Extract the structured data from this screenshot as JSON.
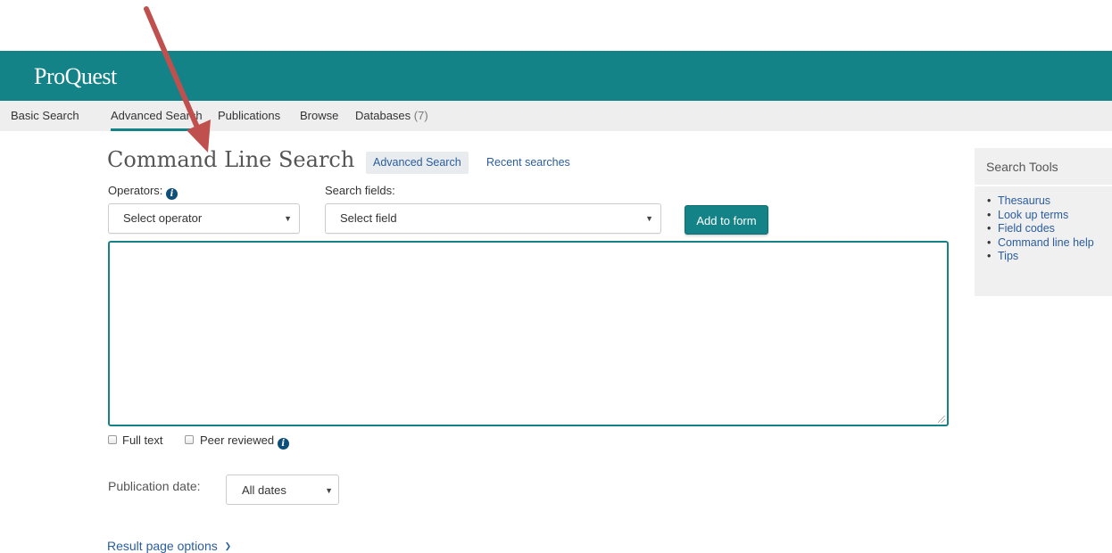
{
  "header": {
    "logo": "ProQuest",
    "brand_color": "#138388"
  },
  "nav": {
    "items": [
      {
        "label": "Basic Search"
      },
      {
        "label": "Advanced Search"
      },
      {
        "label": "Publications"
      },
      {
        "label": "Browse"
      },
      {
        "label": "Databases",
        "count": "(7)"
      }
    ],
    "active": "Advanced Search"
  },
  "main": {
    "title": "Command Line Search",
    "advanced_link": "Advanced Search",
    "recent_link": "Recent searches",
    "operators_label": "Operators:",
    "operators_select": "Select operator",
    "fields_label": "Search fields:",
    "fields_select": "Select field",
    "add_button": "Add to form",
    "search_query": "",
    "full_text_label": "Full text",
    "peer_reviewed_label": "Peer reviewed",
    "pubdate_label": "Publication date:",
    "pubdate_select": "All dates",
    "result_options": "Result page options"
  },
  "tools": {
    "title": "Search Tools",
    "items": [
      "Thesaurus",
      "Look up terms",
      "Field codes",
      "Command line help",
      "Tips"
    ]
  },
  "annotation": {
    "arrow_color": "#c0504d"
  }
}
